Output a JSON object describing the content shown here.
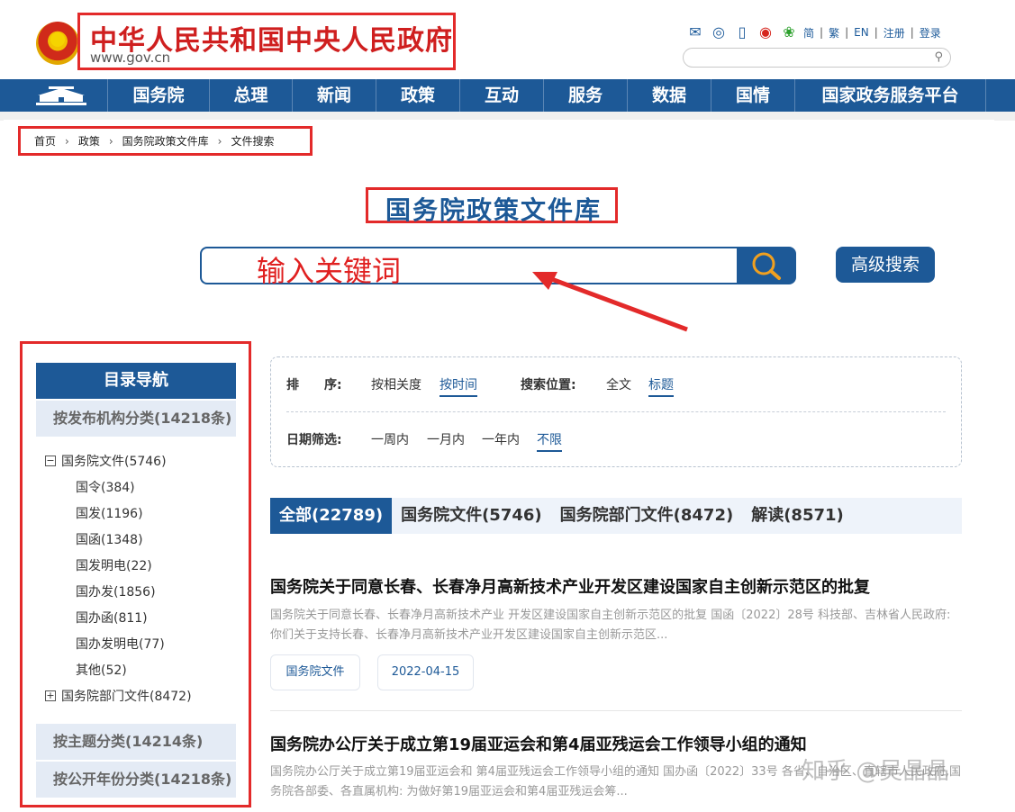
{
  "header": {
    "site_title": "中华人民共和国中央人民政府",
    "site_url": "www.gov.cn",
    "links": [
      "简",
      "繁",
      "EN",
      "注册",
      "登录"
    ]
  },
  "nav": {
    "items": [
      "国务院",
      "总理",
      "新闻",
      "政策",
      "互动",
      "服务",
      "数据",
      "国情",
      "国家政务服务平台"
    ]
  },
  "breadcrumb": [
    "首页",
    "政策",
    "国务院政策文件库",
    "文件搜索"
  ],
  "library_title": "国务院政策文件库",
  "search": {
    "placeholder": "输入关键词",
    "advanced_label": "高级搜索"
  },
  "sidebar": {
    "header": "目录导航",
    "cat_by_agency": "按发布机构分类(14218条)",
    "tree_root_1": "国务院文件(5746)",
    "tree_children": [
      "国令(384)",
      "国发(1196)",
      "国函(1348)",
      "国发明电(22)",
      "国办发(1856)",
      "国办函(811)",
      "国办发明电(77)",
      "其他(52)"
    ],
    "tree_root_2": "国务院部门文件(8472)",
    "cat_by_topic": "按主题分类(14214条)",
    "cat_by_year": "按公开年份分类(14218条)"
  },
  "filters": {
    "sort_label": "排　　序:",
    "sort_options": [
      "按相关度",
      "按时间"
    ],
    "position_label": "搜索位置:",
    "position_options": [
      "全文",
      "标题"
    ],
    "date_label": "日期筛选:",
    "date_options": [
      "一周内",
      "一月内",
      "一年内",
      "不限"
    ]
  },
  "tabs": [
    "全部(22789)",
    "国务院文件(5746)",
    "国务院部门文件(8472)",
    "解读(8571)"
  ],
  "results": [
    {
      "title": "国务院关于同意长春、长春净月高新技术产业开发区建设国家自主创新示范区的批复",
      "summary": "国务院关于同意长春、长春净月高新技术产业 开发区建设国家自主创新示范区的批复 国函〔2022〕28号 科技部、吉林省人民政府: 你们关于支持长春、长春净月高新技术产业开发区建设国家自主创新示范区...",
      "tag": "国务院文件",
      "date": "2022-04-15"
    },
    {
      "title": "国务院办公厅关于成立第19届亚运会和第4届亚残运会工作领导小组的通知",
      "summary": "国务院办公厅关于成立第19届亚运会和 第4届亚残运会工作领导小组的通知 国办函〔2022〕33号 各省、自治区、直辖市人民政府,国务院各部委、各直属机构: 为做好第19届亚运会和第4届亚残运会筹..."
    }
  ],
  "watermark": "知乎 @吴晶晶",
  "colors": {
    "primary": "#1d5997",
    "annotation_red": "#e32a2a"
  }
}
